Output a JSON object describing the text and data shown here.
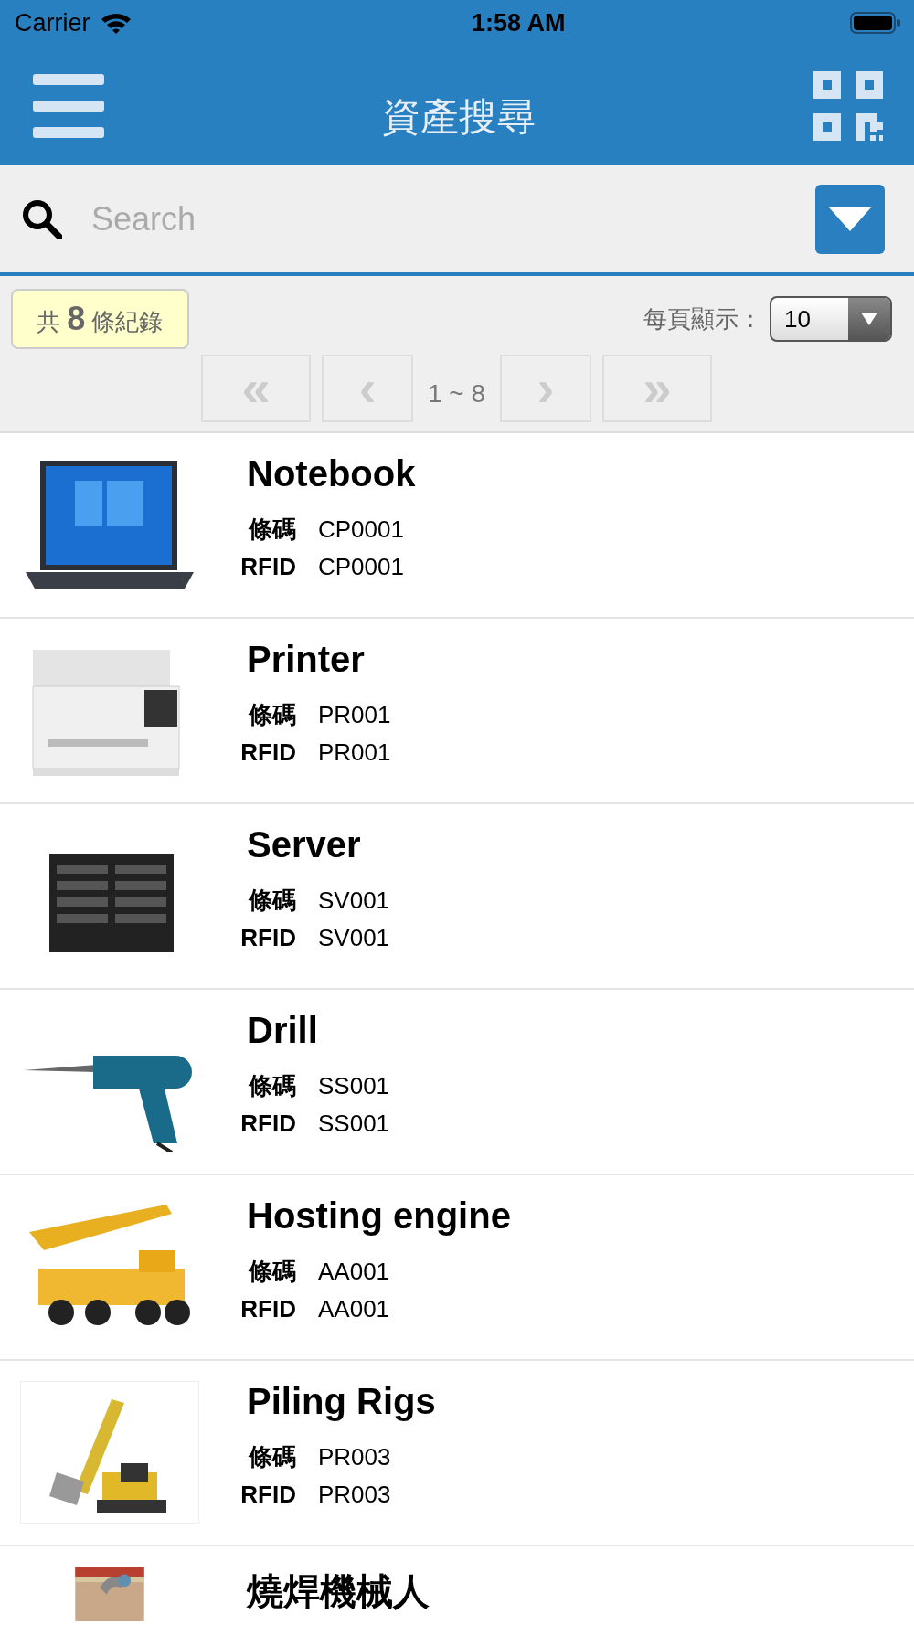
{
  "status_bar": {
    "carrier": "Carrier",
    "time": "1:58 AM"
  },
  "header": {
    "title": "資產搜尋"
  },
  "search": {
    "placeholder": "Search"
  },
  "summary": {
    "prefix": "共",
    "count": "8",
    "suffix": "條紀錄",
    "per_page_label": "每頁顯示：",
    "per_page": "10"
  },
  "pager": {
    "first": "«",
    "prev": "‹",
    "range": "1 ~ 8",
    "next": "›",
    "last": "»",
    "disabled": true
  },
  "items": [
    {
      "kind": "laptop",
      "name": "Notebook",
      "fields": [
        {
          "label": "條碼",
          "value": "CP0001"
        },
        {
          "label": "RFID",
          "value": "CP0001"
        }
      ]
    },
    {
      "kind": "printer",
      "name": "Printer",
      "fields": [
        {
          "label": "條碼",
          "value": "PR001"
        },
        {
          "label": "RFID",
          "value": "PR001"
        }
      ]
    },
    {
      "kind": "server",
      "name": "Server",
      "fields": [
        {
          "label": "條碼",
          "value": "SV001"
        },
        {
          "label": "RFID",
          "value": "SV001"
        }
      ]
    },
    {
      "kind": "drill",
      "name": "Drill",
      "fields": [
        {
          "label": "條碼",
          "value": "SS001"
        },
        {
          "label": "RFID",
          "value": "SS001"
        }
      ]
    },
    {
      "kind": "crane",
      "name": "Hosting engine",
      "fields": [
        {
          "label": "條碼",
          "value": "AA001"
        },
        {
          "label": "RFID",
          "value": "AA001"
        }
      ]
    },
    {
      "kind": "rig",
      "name": "Piling Rigs",
      "fields": [
        {
          "label": "條碼",
          "value": "PR003"
        },
        {
          "label": "RFID",
          "value": "PR003"
        }
      ]
    },
    {
      "kind": "robot",
      "name": "燒焊機械人"
    }
  ]
}
